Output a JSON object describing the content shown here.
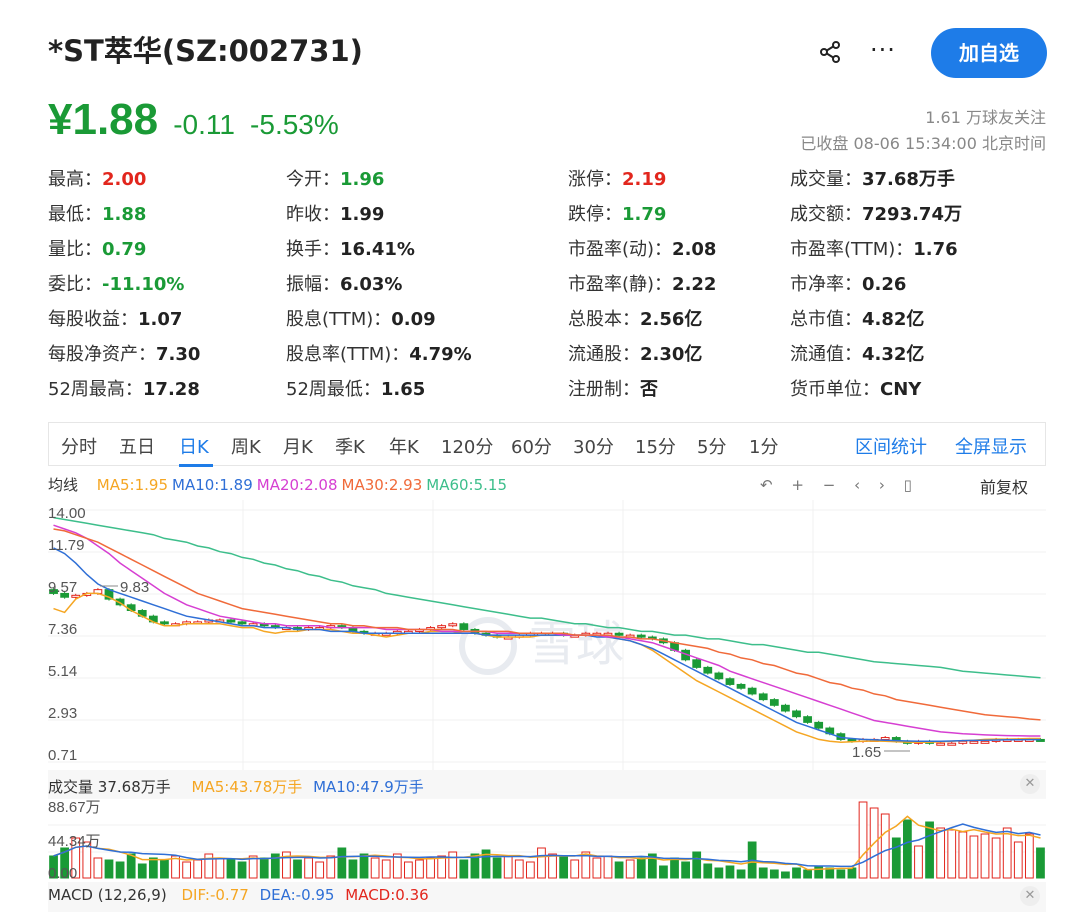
{
  "header": {
    "title": "*ST萃华(SZ:002731)",
    "add_button": "加自选",
    "more_label": "···"
  },
  "quote": {
    "price": "¥1.88",
    "change": "-0.11",
    "change_pct": "-5.53%",
    "followers": "1.61 万球友关注",
    "status": "已收盘 08-06 15:34:00 北京时间"
  },
  "stats": [
    [
      {
        "label": "最高：",
        "value": "2.00",
        "tone": "red"
      },
      {
        "label": "今开：",
        "value": "1.96",
        "tone": "green"
      },
      {
        "label": "涨停：",
        "value": "2.19",
        "tone": "red"
      },
      {
        "label": "成交量：",
        "value": "37.68万手",
        "tone": ""
      }
    ],
    [
      {
        "label": "最低：",
        "value": "1.88",
        "tone": "green"
      },
      {
        "label": "昨收：",
        "value": "1.99",
        "tone": ""
      },
      {
        "label": "跌停：",
        "value": "1.79",
        "tone": "green"
      },
      {
        "label": "成交额：",
        "value": "7293.74万",
        "tone": ""
      }
    ],
    [
      {
        "label": "量比：",
        "value": "0.79",
        "tone": "green"
      },
      {
        "label": "换手：",
        "value": "16.41%",
        "tone": ""
      },
      {
        "label": "市盈率(动)：",
        "value": "2.08",
        "tone": ""
      },
      {
        "label": "市盈率(TTM)：",
        "value": "1.76",
        "tone": ""
      }
    ],
    [
      {
        "label": "委比：",
        "value": "-11.10%",
        "tone": "green"
      },
      {
        "label": "振幅：",
        "value": "6.03%",
        "tone": ""
      },
      {
        "label": "市盈率(静)：",
        "value": "2.22",
        "tone": ""
      },
      {
        "label": "市净率：",
        "value": "0.26",
        "tone": ""
      }
    ],
    [
      {
        "label": "每股收益：",
        "value": "1.07",
        "tone": ""
      },
      {
        "label": "股息(TTM)：",
        "value": "0.09",
        "tone": ""
      },
      {
        "label": "总股本：",
        "value": "2.56亿",
        "tone": ""
      },
      {
        "label": "总市值：",
        "value": "4.82亿",
        "tone": ""
      }
    ],
    [
      {
        "label": "每股净资产：",
        "value": "7.30",
        "tone": ""
      },
      {
        "label": "股息率(TTM)：",
        "value": "4.79%",
        "tone": ""
      },
      {
        "label": "流通股：",
        "value": "2.30亿",
        "tone": ""
      },
      {
        "label": "流通值：",
        "value": "4.32亿",
        "tone": ""
      }
    ],
    [
      {
        "label": "52周最高：",
        "value": "17.28",
        "tone": ""
      },
      {
        "label": "52周最低：",
        "value": "1.65",
        "tone": ""
      },
      {
        "label": "注册制：",
        "value": "否",
        "tone": ""
      },
      {
        "label": "货币单位：",
        "value": "CNY",
        "tone": ""
      }
    ]
  ],
  "tabs": [
    "分时",
    "五日",
    "日K",
    "周K",
    "月K",
    "季K",
    "年K",
    "120分",
    "60分",
    "30分",
    "15分",
    "5分",
    "1分"
  ],
  "active_tab": "日K",
  "links": {
    "range_stats": "区间统计",
    "fullscreen": "全屏显示"
  },
  "ma_legend": {
    "title": "均线",
    "items": [
      {
        "text": "MA5:1.95",
        "color": "#F5A623"
      },
      {
        "text": "MA10:1.89",
        "color": "#2F6FD6"
      },
      {
        "text": "MA20:2.08",
        "color": "#D63FD2"
      },
      {
        "text": "MA30:2.93",
        "color": "#F06A3A"
      },
      {
        "text": "MA60:5.15",
        "color": "#3DBE8B"
      }
    ]
  },
  "chart_tools": {
    "undo": "↶",
    "zoom_in": "+",
    "zoom_out": "−",
    "prev": "‹",
    "next": "›",
    "candle": "▯",
    "adjust": "前复权"
  },
  "watermark": "雪球",
  "price_axis": [
    "14.00",
    "11.79",
    "9.57",
    "7.36",
    "5.14",
    "2.93",
    "0.71"
  ],
  "annotations": {
    "high": "9.83",
    "low": "1.65"
  },
  "volume": {
    "title": "成交量",
    "value": "37.68万手",
    "ma5": "MA5:43.78万手",
    "ma10": "MA10:47.9万手",
    "axis": [
      "88.67万",
      "44.34万",
      "0.00"
    ]
  },
  "macd": {
    "title": "MACD (12,26,9)",
    "dif": "DIF:-0.77",
    "dea": "DEA:-0.95",
    "macd": "MACD:0.36"
  },
  "colors": {
    "up": "#e2261d",
    "down": "#1a9a36",
    "accent": "#1E7CE8"
  },
  "chart_data": {
    "type": "line",
    "title": "",
    "candles_close": [
      9.6,
      9.4,
      9.5,
      9.6,
      9.8,
      9.3,
      9.0,
      8.7,
      8.4,
      8.1,
      8.0,
      8.0,
      8.1,
      8.1,
      8.2,
      8.2,
      8.1,
      8.0,
      8.0,
      7.9,
      7.8,
      7.8,
      7.7,
      7.8,
      7.8,
      7.9,
      7.8,
      7.6,
      7.5,
      7.5,
      7.5,
      7.6,
      7.6,
      7.7,
      7.8,
      7.9,
      8.0,
      7.7,
      7.5,
      7.4,
      7.3,
      7.3,
      7.4,
      7.5,
      7.5,
      7.5,
      7.4,
      7.4,
      7.5,
      7.5,
      7.5,
      7.4,
      7.4,
      7.3,
      7.2,
      7.0,
      6.6,
      6.1,
      5.7,
      5.4,
      5.1,
      4.8,
      4.6,
      4.3,
      4.0,
      3.7,
      3.4,
      3.1,
      2.8,
      2.5,
      2.2,
      1.9,
      1.8,
      1.9,
      1.9,
      2.0,
      1.8,
      1.7,
      1.8,
      1.7,
      1.7,
      1.7,
      1.8,
      1.8,
      1.8,
      1.9,
      1.9,
      1.9,
      1.9,
      1.88
    ],
    "ylim": [
      0.71,
      14.0
    ],
    "series": [
      {
        "name": "MA5",
        "values": [
          8.8,
          8.6,
          9.3,
          9.6,
          9.6,
          9.4,
          9.1,
          8.7,
          8.4,
          8.1,
          7.9,
          7.9,
          8.0,
          8.0,
          8.0,
          8.0,
          7.9,
          7.8,
          7.8,
          7.6,
          7.5,
          7.6,
          7.6,
          7.7,
          7.7,
          7.7,
          7.6,
          7.5,
          7.5,
          7.4,
          7.3,
          7.4,
          7.5,
          7.5,
          7.6,
          7.6,
          7.6,
          7.5,
          7.5,
          7.4,
          7.3,
          7.3,
          7.3,
          7.3,
          7.4,
          7.4,
          7.4,
          7.4,
          7.4,
          7.4,
          7.3,
          7.2,
          7.1,
          6.9,
          6.6,
          6.2,
          5.8,
          5.4,
          5.0,
          4.7,
          4.4,
          4.1,
          3.8,
          3.5,
          3.2,
          2.9,
          2.6,
          2.3,
          2.1,
          1.9,
          1.8,
          1.75,
          1.78,
          1.8,
          1.82,
          1.8,
          1.78,
          1.76,
          1.75,
          1.75,
          1.78,
          1.8,
          1.84,
          1.86,
          1.9,
          1.92,
          1.92,
          1.93,
          1.95,
          1.95
        ]
      },
      {
        "name": "MA10",
        "values": [
          12.0,
          11.7,
          11.2,
          10.6,
          10.1,
          9.8,
          9.6,
          9.4,
          9.2,
          9.0,
          8.8,
          8.6,
          8.4,
          8.3,
          8.2,
          8.1,
          8.0,
          7.9,
          7.9,
          7.8,
          7.8,
          7.8,
          7.7,
          7.7,
          7.7,
          7.6,
          7.6,
          7.6,
          7.5,
          7.5,
          7.5,
          7.5,
          7.5,
          7.5,
          7.5,
          7.5,
          7.5,
          7.5,
          7.5,
          7.4,
          7.4,
          7.4,
          7.4,
          7.4,
          7.4,
          7.4,
          7.4,
          7.4,
          7.4,
          7.3,
          7.3,
          7.2,
          7.1,
          6.9,
          6.7,
          6.4,
          6.1,
          5.8,
          5.5,
          5.2,
          4.9,
          4.6,
          4.3,
          4.0,
          3.7,
          3.4,
          3.1,
          2.8,
          2.6,
          2.4,
          2.2,
          2.0,
          1.95,
          1.9,
          1.88,
          1.86,
          1.84,
          1.82,
          1.8,
          1.8,
          1.8,
          1.82,
          1.84,
          1.85,
          1.86,
          1.87,
          1.88,
          1.88,
          1.89,
          1.89
        ]
      },
      {
        "name": "MA20",
        "values": [
          13.2,
          13.0,
          12.8,
          12.5,
          12.1,
          11.7,
          11.2,
          10.8,
          10.4,
          10.0,
          9.6,
          9.3,
          9.0,
          8.8,
          8.6,
          8.4,
          8.3,
          8.2,
          8.1,
          8.0,
          8.0,
          7.9,
          7.9,
          7.9,
          7.9,
          7.8,
          7.8,
          7.8,
          7.8,
          7.8,
          7.7,
          7.7,
          7.7,
          7.7,
          7.7,
          7.6,
          7.6,
          7.6,
          7.6,
          7.6,
          7.5,
          7.5,
          7.5,
          7.5,
          7.5,
          7.5,
          7.4,
          7.4,
          7.4,
          7.4,
          7.3,
          7.3,
          7.2,
          7.1,
          7.0,
          6.8,
          6.6,
          6.4,
          6.2,
          6.0,
          5.8,
          5.5,
          5.3,
          5.1,
          4.9,
          4.7,
          4.5,
          4.3,
          4.1,
          3.9,
          3.7,
          3.5,
          3.3,
          3.1,
          2.9,
          2.8,
          2.7,
          2.6,
          2.5,
          2.4,
          2.3,
          2.25,
          2.2,
          2.17,
          2.14,
          2.12,
          2.1,
          2.09,
          2.08,
          2.08
        ]
      },
      {
        "name": "MA30",
        "values": [
          13.0,
          12.9,
          12.7,
          12.5,
          12.3,
          12.0,
          11.7,
          11.4,
          11.1,
          10.8,
          10.5,
          10.2,
          9.9,
          9.6,
          9.4,
          9.2,
          9.0,
          8.8,
          8.7,
          8.6,
          8.5,
          8.4,
          8.3,
          8.2,
          8.1,
          8.0,
          8.0,
          7.9,
          7.9,
          7.8,
          7.8,
          7.8,
          7.7,
          7.7,
          7.7,
          7.7,
          7.7,
          7.6,
          7.6,
          7.6,
          7.6,
          7.6,
          7.5,
          7.5,
          7.5,
          7.5,
          7.5,
          7.4,
          7.4,
          7.4,
          7.4,
          7.3,
          7.3,
          7.2,
          7.2,
          7.1,
          7.0,
          6.9,
          6.8,
          6.7,
          6.5,
          6.4,
          6.2,
          6.1,
          5.9,
          5.8,
          5.6,
          5.4,
          5.3,
          5.1,
          4.9,
          4.8,
          4.6,
          4.5,
          4.3,
          4.2,
          4.0,
          3.9,
          3.8,
          3.7,
          3.6,
          3.5,
          3.4,
          3.3,
          3.2,
          3.15,
          3.1,
          3.05,
          2.98,
          2.93
        ]
      },
      {
        "name": "MA60",
        "values": [
          13.6,
          13.5,
          13.4,
          13.3,
          13.2,
          13.1,
          13.0,
          12.9,
          12.8,
          12.7,
          12.5,
          12.4,
          12.3,
          12.1,
          12.0,
          11.8,
          11.7,
          11.5,
          11.4,
          11.2,
          11.1,
          10.9,
          10.8,
          10.6,
          10.5,
          10.3,
          10.2,
          10.0,
          9.9,
          9.8,
          9.6,
          9.5,
          9.4,
          9.3,
          9.2,
          9.1,
          9.0,
          8.9,
          8.8,
          8.7,
          8.6,
          8.5,
          8.4,
          8.3,
          8.3,
          8.2,
          8.1,
          8.0,
          8.0,
          7.9,
          7.8,
          7.8,
          7.7,
          7.6,
          7.6,
          7.5,
          7.4,
          7.4,
          7.3,
          7.2,
          7.2,
          7.1,
          7.0,
          6.9,
          6.9,
          6.8,
          6.7,
          6.6,
          6.5,
          6.5,
          6.4,
          6.3,
          6.2,
          6.1,
          6.0,
          5.95,
          5.9,
          5.85,
          5.8,
          5.75,
          5.7,
          5.6,
          5.5,
          5.45,
          5.4,
          5.35,
          5.3,
          5.25,
          5.2,
          5.15
        ]
      }
    ]
  }
}
